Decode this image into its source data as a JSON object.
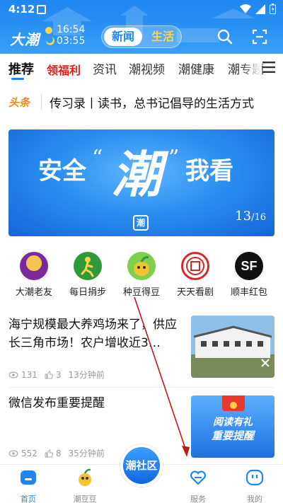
{
  "status_bar": {
    "time": "4:12"
  },
  "header": {
    "brand": "大潮",
    "clock_time": "16:54",
    "clock_time2": "03:55",
    "segments": [
      "新闻",
      "生活"
    ],
    "icons": [
      "search-icon",
      "scan-icon"
    ],
    "colors": {
      "primary": "#1f86f0",
      "accent_yellow": "#ffd24a"
    }
  },
  "tabs": [
    {
      "label": "推荐",
      "active": true
    },
    {
      "label": "领福利",
      "highlight": true
    },
    {
      "label": "资讯"
    },
    {
      "label": "潮视频"
    },
    {
      "label": "潮健康"
    },
    {
      "label": "潮专题"
    }
  ],
  "headline": {
    "badge": "头条",
    "text": "传习录丨读书，总书记倡导的生活方式"
  },
  "banner": {
    "pre": "安全",
    "quote_open": "“",
    "big": "潮",
    "quote_close": "”",
    "post": "我看",
    "counter_current": "13",
    "counter_total": "/16",
    "logo": "潮"
  },
  "shortcuts": [
    {
      "label": "大潮老友",
      "icon": "old-friends-icon"
    },
    {
      "label": "每日捐步",
      "icon": "runner-icon"
    },
    {
      "label": "种豆得豆",
      "icon": "bean-icon"
    },
    {
      "label": "天天看剧",
      "icon": "drama-icon"
    },
    {
      "label": "顺丰红包",
      "icon": "sf-icon"
    }
  ],
  "news": [
    {
      "title": "海宁规模最大养鸡场来了，供应长三角市场！农户增收近3…",
      "views": "131",
      "likes": "3",
      "time": "13分钟前"
    },
    {
      "title": "微信发布重要提醒",
      "views": "552",
      "likes": "8",
      "time": "35分钟前",
      "thumb_text": "阅读有礼",
      "thumb_sub": "重要提醒"
    }
  ],
  "bottom_nav": [
    {
      "label": "首页",
      "icon": "home-icon",
      "active": true
    },
    {
      "label": "潮豆豆",
      "icon": "mascot-icon"
    },
    {
      "label": "潮社区",
      "icon": "community-icon",
      "center": true
    },
    {
      "label": "服务",
      "icon": "heart-service-icon"
    },
    {
      "label": "我的",
      "icon": "profile-icon"
    }
  ]
}
